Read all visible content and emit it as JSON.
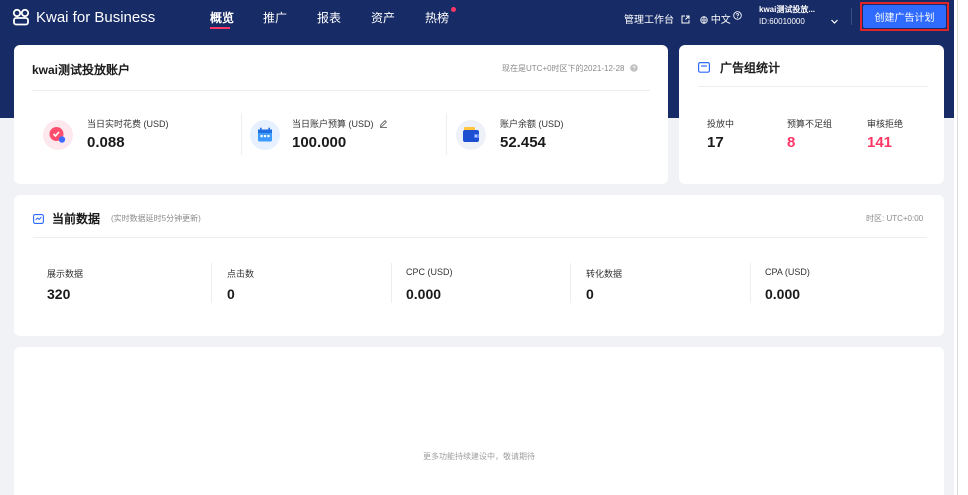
{
  "topbar": {
    "brand": "Kwai for Business",
    "nav": [
      "概览",
      "推广",
      "报表",
      "资产",
      "热榜"
    ],
    "workbench": "管理工作台",
    "language": "中文",
    "help_icon": "question-circle-icon",
    "account_name": "kwai测试投放...",
    "account_id": "ID:60010000",
    "create_button": "创建广告计划"
  },
  "account_card": {
    "title": "kwai测试投放账户",
    "time_note": "现在是UTC+0时区下的2021-12-28",
    "stats": [
      {
        "label": "当日实时花费 (USD)",
        "value": "0.088",
        "icon": "spend-icon"
      },
      {
        "label": "当日账户预算 (USD)",
        "value": "100.000",
        "icon": "budget-icon"
      },
      {
        "label": "账户余额 (USD)",
        "value": "52.454",
        "icon": "wallet-icon"
      }
    ]
  },
  "adgroup_card": {
    "title": "广告组统计",
    "stats": [
      {
        "label": "投放中",
        "value": "17"
      },
      {
        "label": "预算不足组",
        "value": "8"
      },
      {
        "label": "审核拒绝",
        "value": "141"
      }
    ]
  },
  "current_card": {
    "title": "当前数据",
    "subtitle": "(实时数据延时5分钟更新)",
    "timezone": "时区: UTC+0:00",
    "metrics": [
      {
        "label": "展示数据",
        "value": "320"
      },
      {
        "label": "点击数",
        "value": "0"
      },
      {
        "label": "CPC (USD)",
        "value": "0.000"
      },
      {
        "label": "转化数据",
        "value": "0"
      },
      {
        "label": "CPA (USD)",
        "value": "0.000"
      }
    ]
  },
  "placeholder_card": {
    "text": "更多功能持续建设中，敬请期待"
  },
  "colors": {
    "header_bg": "#172b66",
    "primary": "#2f6bff",
    "accent_red": "#fe3666"
  }
}
